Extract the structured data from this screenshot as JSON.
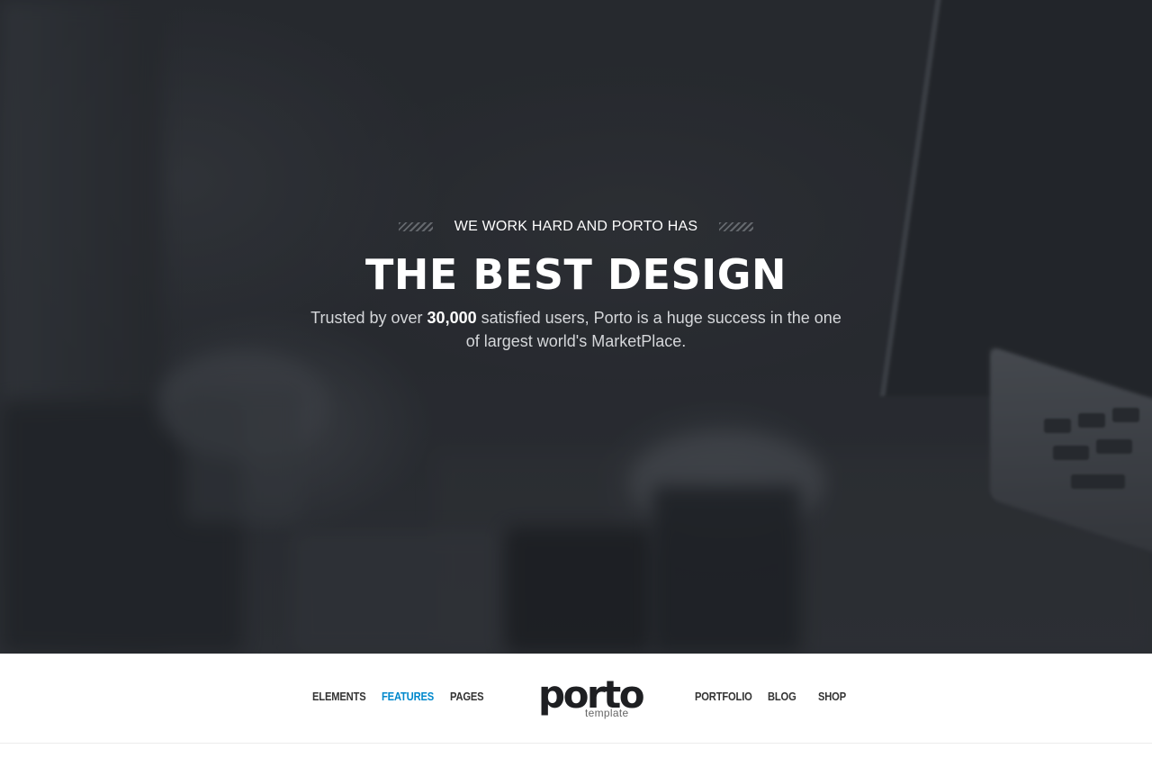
{
  "hero": {
    "kicker": "WE WORK HARD AND PORTO HAS",
    "title": "THE BEST DESIGN",
    "text_before": "Trusted by over ",
    "text_strong": "30,000",
    "text_after": " satisfied users, Porto is a huge success in the one of largest world's MarketPlace."
  },
  "nav": {
    "left_items": [
      {
        "label": "ELEMENTS",
        "active": false
      },
      {
        "label": "FEATURES",
        "active": true
      },
      {
        "label": "PAGES",
        "active": false
      }
    ],
    "right_items": [
      {
        "label": "PORTFOLIO",
        "active": false
      },
      {
        "label": "BLOG",
        "active": false
      },
      {
        "label": "SHOP",
        "active": false
      }
    ],
    "logo_word": "porto",
    "logo_sub": "template"
  },
  "colors": {
    "accent": "#0088cc",
    "nav_text": "#333333",
    "hero_overlay": "#1c1f24"
  }
}
